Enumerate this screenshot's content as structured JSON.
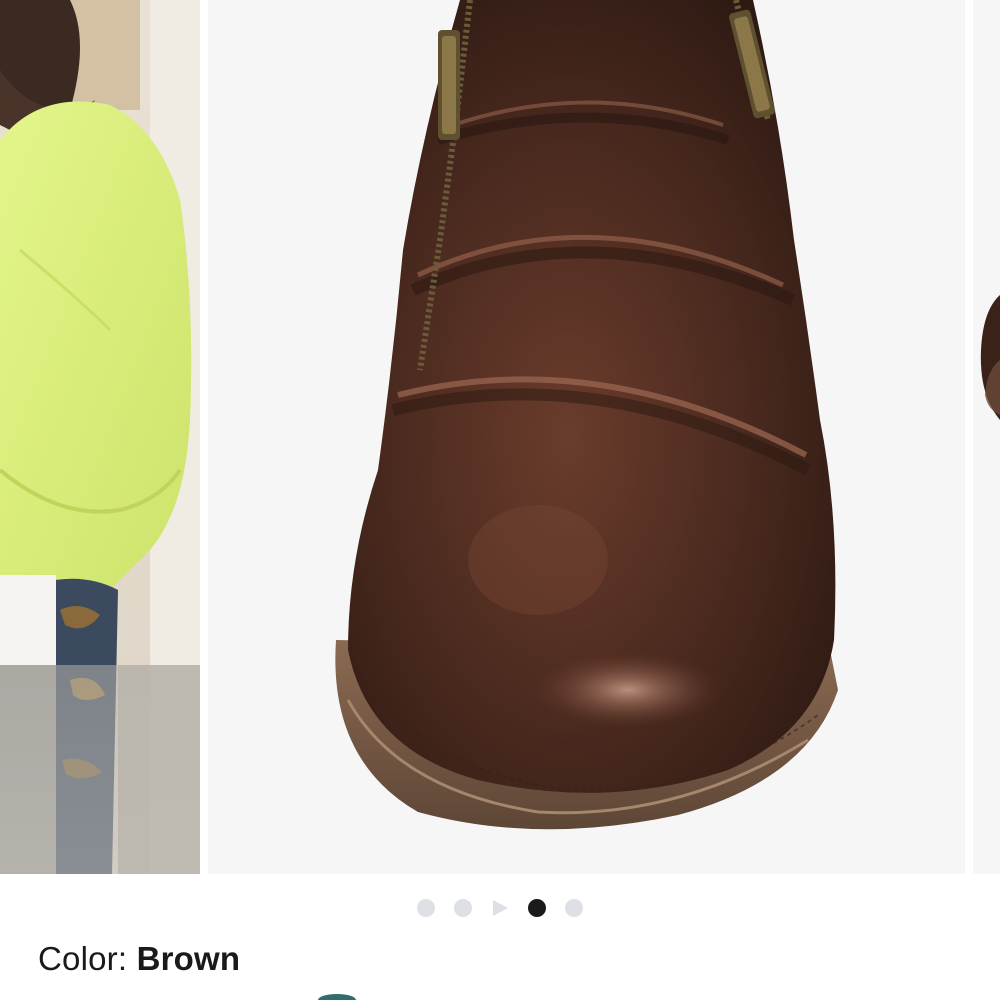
{
  "carousel": {
    "slides": [
      {
        "label": "model-wearing-lime-sweater"
      },
      {
        "label": "brown-leather-boot-closeup"
      },
      {
        "label": "next-boot-image-peek"
      }
    ],
    "pagination": {
      "items": [
        "dot",
        "dot",
        "video",
        "dot",
        "dot"
      ],
      "active_index": 3,
      "active_color": "#1a1a1a",
      "inactive_color": "#dde1e6"
    }
  },
  "color_selector": {
    "label": "Color:",
    "value": "Brown"
  }
}
